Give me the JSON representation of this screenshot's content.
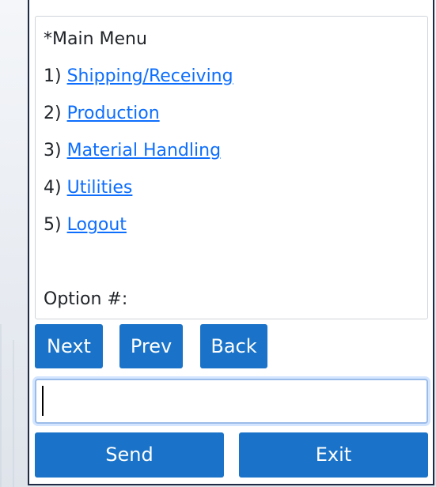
{
  "menu": {
    "title": "*Main Menu",
    "items": [
      {
        "number": "1)",
        "label": "Shipping/Receiving"
      },
      {
        "number": "2)",
        "label": "Production"
      },
      {
        "number": "3)",
        "label": "Material Handling"
      },
      {
        "number": "4)",
        "label": "Utilities"
      },
      {
        "number": "5)",
        "label": "Logout"
      }
    ],
    "prompt": "Option #:"
  },
  "nav": {
    "next_label": "Next",
    "prev_label": "Prev",
    "back_label": "Back"
  },
  "input": {
    "value": "",
    "placeholder": ""
  },
  "actions": {
    "send_label": "Send",
    "exit_label": "Exit"
  },
  "colors": {
    "button": "#1a73c8",
    "link": "#0d6efd",
    "frame_border": "#1f2a44",
    "input_focus": "#9bbce8"
  }
}
